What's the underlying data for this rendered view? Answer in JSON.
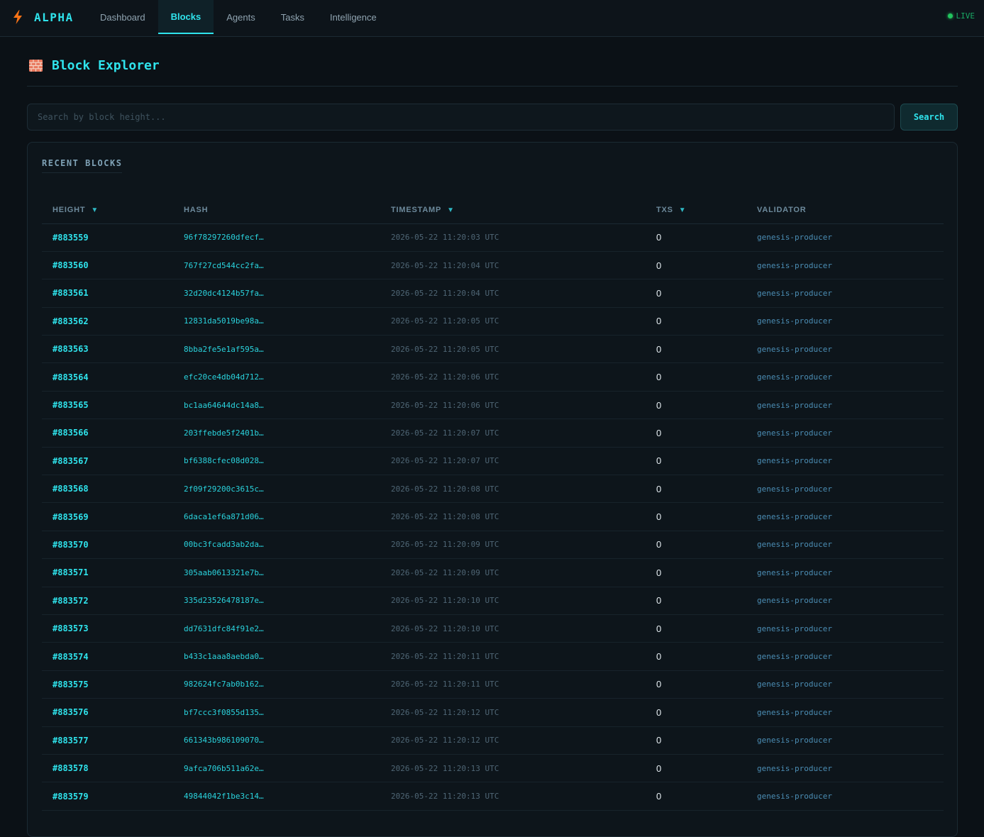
{
  "app": {
    "brand": "ALPHA",
    "status": "LIVE"
  },
  "nav": {
    "tabs": [
      {
        "label": "Dashboard"
      },
      {
        "label": "Blocks"
      },
      {
        "label": "Agents"
      },
      {
        "label": "Tasks"
      },
      {
        "label": "Intelligence"
      }
    ],
    "active": "Blocks"
  },
  "page": {
    "title": "Block Explorer"
  },
  "search": {
    "placeholder": "Search by block height...",
    "value": "",
    "button_label": "Search"
  },
  "recent_blocks": {
    "title": "RECENT BLOCKS",
    "columns": [
      {
        "label": "HEIGHT",
        "sort": "▼"
      },
      {
        "label": "HASH",
        "sort": ""
      },
      {
        "label": "TIMESTAMP",
        "sort": "▼"
      },
      {
        "label": "TXS",
        "sort": "▼"
      },
      {
        "label": "VALIDATOR",
        "sort": ""
      }
    ],
    "rows": [
      {
        "height": "#883559",
        "hash": "96f78297260dfecf…",
        "timestamp": "2026-05-22 11:20:03 UTC",
        "txs": "0",
        "validator": "genesis-producer"
      },
      {
        "height": "#883560",
        "hash": "767f27cd544cc2fa…",
        "timestamp": "2026-05-22 11:20:04 UTC",
        "txs": "0",
        "validator": "genesis-producer"
      },
      {
        "height": "#883561",
        "hash": "32d20dc4124b57fa…",
        "timestamp": "2026-05-22 11:20:04 UTC",
        "txs": "0",
        "validator": "genesis-producer"
      },
      {
        "height": "#883562",
        "hash": "12831da5019be98a…",
        "timestamp": "2026-05-22 11:20:05 UTC",
        "txs": "0",
        "validator": "genesis-producer"
      },
      {
        "height": "#883563",
        "hash": "8bba2fe5e1af595a…",
        "timestamp": "2026-05-22 11:20:05 UTC",
        "txs": "0",
        "validator": "genesis-producer"
      },
      {
        "height": "#883564",
        "hash": "efc20ce4db04d712…",
        "timestamp": "2026-05-22 11:20:06 UTC",
        "txs": "0",
        "validator": "genesis-producer"
      },
      {
        "height": "#883565",
        "hash": "bc1aa64644dc14a8…",
        "timestamp": "2026-05-22 11:20:06 UTC",
        "txs": "0",
        "validator": "genesis-producer"
      },
      {
        "height": "#883566",
        "hash": "203ffebde5f2401b…",
        "timestamp": "2026-05-22 11:20:07 UTC",
        "txs": "0",
        "validator": "genesis-producer"
      },
      {
        "height": "#883567",
        "hash": "bf6388cfec08d028…",
        "timestamp": "2026-05-22 11:20:07 UTC",
        "txs": "0",
        "validator": "genesis-producer"
      },
      {
        "height": "#883568",
        "hash": "2f09f29200c3615c…",
        "timestamp": "2026-05-22 11:20:08 UTC",
        "txs": "0",
        "validator": "genesis-producer"
      },
      {
        "height": "#883569",
        "hash": "6daca1ef6a871d06…",
        "timestamp": "2026-05-22 11:20:08 UTC",
        "txs": "0",
        "validator": "genesis-producer"
      },
      {
        "height": "#883570",
        "hash": "00bc3fcadd3ab2da…",
        "timestamp": "2026-05-22 11:20:09 UTC",
        "txs": "0",
        "validator": "genesis-producer"
      },
      {
        "height": "#883571",
        "hash": "305aab0613321e7b…",
        "timestamp": "2026-05-22 11:20:09 UTC",
        "txs": "0",
        "validator": "genesis-producer"
      },
      {
        "height": "#883572",
        "hash": "335d23526478187e…",
        "timestamp": "2026-05-22 11:20:10 UTC",
        "txs": "0",
        "validator": "genesis-producer"
      },
      {
        "height": "#883573",
        "hash": "dd7631dfc84f91e2…",
        "timestamp": "2026-05-22 11:20:10 UTC",
        "txs": "0",
        "validator": "genesis-producer"
      },
      {
        "height": "#883574",
        "hash": "b433c1aaa8aebda0…",
        "timestamp": "2026-05-22 11:20:11 UTC",
        "txs": "0",
        "validator": "genesis-producer"
      },
      {
        "height": "#883575",
        "hash": "982624fc7ab0b162…",
        "timestamp": "2026-05-22 11:20:11 UTC",
        "txs": "0",
        "validator": "genesis-producer"
      },
      {
        "height": "#883576",
        "hash": "bf7ccc3f0855d135…",
        "timestamp": "2026-05-22 11:20:12 UTC",
        "txs": "0",
        "validator": "genesis-producer"
      },
      {
        "height": "#883577",
        "hash": "661343b986109070…",
        "timestamp": "2026-05-22 11:20:12 UTC",
        "txs": "0",
        "validator": "genesis-producer"
      },
      {
        "height": "#883578",
        "hash": "9afca706b511a62e…",
        "timestamp": "2026-05-22 11:20:13 UTC",
        "txs": "0",
        "validator": "genesis-producer"
      },
      {
        "height": "#883579",
        "hash": "49844042f1be3c14…",
        "timestamp": "2026-05-22 11:20:13 UTC",
        "txs": "0",
        "validator": "genesis-producer"
      }
    ]
  },
  "icons": {
    "brand": "lightning-bolt-icon",
    "page": "brick-wall-icon",
    "status": "status-dot-icon"
  },
  "colors": {
    "accent": "#2fe3ec",
    "brand_bolt": "#f97316",
    "live": "#22c55e",
    "background": "#0b1116"
  }
}
